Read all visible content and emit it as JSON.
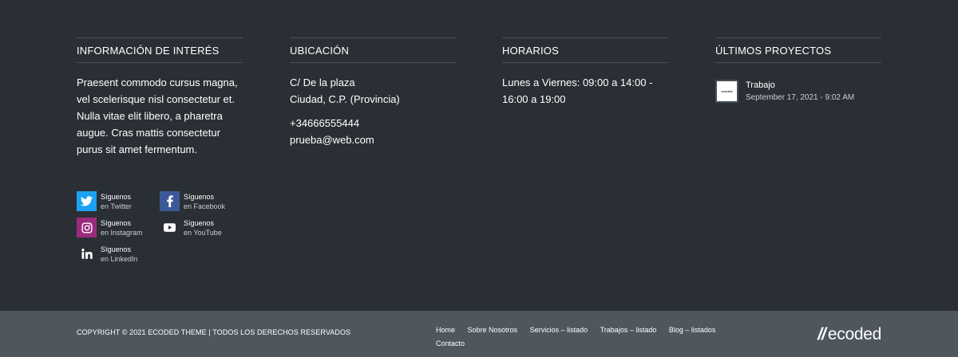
{
  "columns": {
    "info": {
      "title": "INFORMACIÓN DE INTERÉS",
      "text": "Praesent commodo cursus magna, vel scelerisque nisl consectetur et. Nulla vitae elit libero, a pharetra augue. Cras mattis consectetur purus sit amet fermentum."
    },
    "location": {
      "title": "UBICACIÓN",
      "address_line1": "C/ De la plaza",
      "address_line2": "Ciudad, C.P. (Provincia)",
      "phone": "+34666555444",
      "email": "prueba@web.com"
    },
    "hours": {
      "title": "HORARIOS",
      "line1": "Lunes a Viernes: 09:00 a 14:00 -",
      "line2": "16:00 a 19:00"
    },
    "projects": {
      "title": "ÚLTIMOS PROYECTOS",
      "items": [
        {
          "title": "Trabajo",
          "date": "September 17, 2021 - 9:02 AM",
          "thumb_text": "ecoded"
        }
      ]
    }
  },
  "social": [
    {
      "icon": "twitter-icon",
      "line1": "Síguenos",
      "line2": "en Twitter",
      "color": "#1da1f2"
    },
    {
      "icon": "facebook-icon",
      "line1": "Síguenos",
      "line2": "en Facebook",
      "color": "#3b5998"
    },
    {
      "icon": "instagram-icon",
      "line1": "Síguenos",
      "line2": "en Instagram",
      "color": "#9b2a7e"
    },
    {
      "icon": "youtube-icon",
      "line1": "Síguenos",
      "line2": "en YouTube",
      "color": "#2a2f35"
    },
    {
      "icon": "linkedin-icon",
      "line1": "Síguenos",
      "line2": "en LinkedIn",
      "color": "#2a2f35"
    }
  ],
  "bottom": {
    "copyright": "COPYRIGHT © 2021 ECODED THEME | TODOS LOS DERECHOS RESERVADOS",
    "nav": [
      "Home",
      "Sobre Nosotros",
      "Servicios – listado",
      "Trabajos – listado",
      "Blog – listados",
      "Contacto"
    ],
    "logo_mark": "//",
    "logo_text": "ecoded"
  }
}
